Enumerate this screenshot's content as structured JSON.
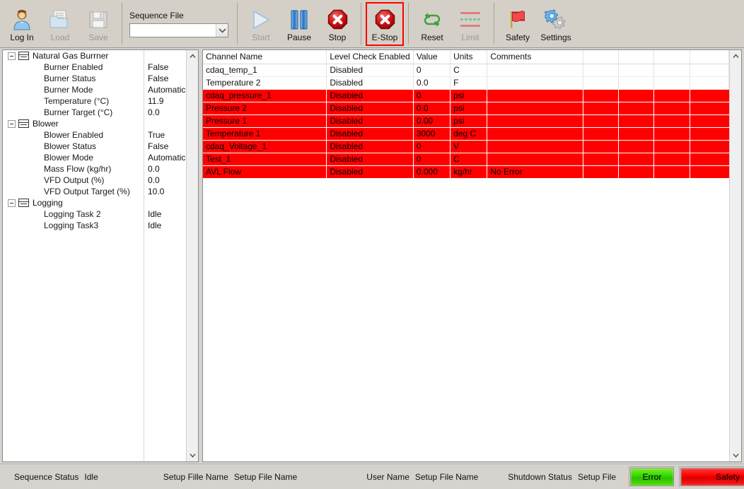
{
  "toolbar": {
    "buttons": [
      {
        "name": "log-in",
        "label": "Log In",
        "icon": "user-icon",
        "disabled": false,
        "selected": false
      },
      {
        "name": "load",
        "label": "Load",
        "icon": "folder-icon",
        "disabled": true,
        "selected": false
      },
      {
        "name": "save",
        "label": "Save",
        "icon": "floppy-icon",
        "disabled": true,
        "selected": false
      },
      {
        "name": "start",
        "label": "Start",
        "icon": "play-icon",
        "disabled": true,
        "selected": false
      },
      {
        "name": "pause",
        "label": "Pause",
        "icon": "pause-icon",
        "disabled": false,
        "selected": false
      },
      {
        "name": "stop",
        "label": "Stop",
        "icon": "stop-octagon-icon",
        "disabled": false,
        "selected": false
      },
      {
        "name": "e-stop",
        "label": "E-Stop",
        "icon": "stop-octagon-icon",
        "disabled": false,
        "selected": true
      },
      {
        "name": "reset",
        "label": "Reset",
        "icon": "refresh-cycle-icon",
        "disabled": false,
        "selected": false
      },
      {
        "name": "limit",
        "label": "Limit",
        "icon": "limit-lines-icon",
        "disabled": true,
        "selected": false
      },
      {
        "name": "safety",
        "label": "Safety",
        "icon": "red-flag-icon",
        "disabled": false,
        "selected": false
      },
      {
        "name": "settings",
        "label": "Settings",
        "icon": "gears-icon",
        "disabled": false,
        "selected": false
      }
    ],
    "sequence_file": {
      "caption": "Sequence File",
      "value": "",
      "placeholder": ""
    },
    "selection_color": "#ff0000"
  },
  "tree": {
    "groups": [
      {
        "label": "Natural Gas Burrner",
        "expanded": true,
        "items": [
          {
            "label": "Burner Enabled",
            "value": "False"
          },
          {
            "label": "Burner Status",
            "value": "False"
          },
          {
            "label": "Burner Mode",
            "value": "Automatic"
          },
          {
            "label": "Temperature (°C)",
            "value": "11.9"
          },
          {
            "label": "Burner Target (°C)",
            "value": "0.0"
          }
        ]
      },
      {
        "label": "Blower",
        "expanded": true,
        "items": [
          {
            "label": "Blower Enabled",
            "value": "True"
          },
          {
            "label": "Blower Status",
            "value": "False"
          },
          {
            "label": "Blower Mode",
            "value": "Automatic"
          },
          {
            "label": "Mass Flow (kg/hr)",
            "value": "0.0"
          },
          {
            "label": "VFD Output (%)",
            "value": "0.0"
          },
          {
            "label": "VFD Output Target (%)",
            "value": "10.0"
          }
        ]
      },
      {
        "label": "Logging",
        "expanded": true,
        "items": [
          {
            "label": "Logging Task 2",
            "value": "Idle"
          },
          {
            "label": "Logging Task3",
            "value": "Idle"
          }
        ]
      }
    ]
  },
  "channel_table": {
    "columns": [
      "Channel Name",
      "Level Check Enabled",
      "Value",
      "Units",
      "Comments",
      "",
      "",
      "",
      ""
    ],
    "alarm_color": "#ff0000",
    "rows": [
      {
        "alarm": false,
        "cells": [
          "cdaq_temp_1",
          "Disabled",
          "0",
          "C",
          "",
          "",
          "",
          "",
          ""
        ]
      },
      {
        "alarm": false,
        "cells": [
          "Temperature 2",
          "Disabled",
          "0.0",
          "F",
          "",
          "",
          "",
          "",
          ""
        ]
      },
      {
        "alarm": true,
        "cells": [
          "cdaq_pressure_1",
          "Disabled",
          "0",
          "psi",
          "",
          "",
          "",
          "",
          ""
        ]
      },
      {
        "alarm": true,
        "cells": [
          "Pressure 2",
          "Disabled",
          "0.0",
          "psi",
          "",
          "",
          "",
          "",
          ""
        ]
      },
      {
        "alarm": true,
        "cells": [
          "Pressure 1",
          "Disabled",
          "0.00",
          "psi",
          "",
          "",
          "",
          "",
          ""
        ]
      },
      {
        "alarm": true,
        "cells": [
          "Temperature 1",
          "Disabled",
          "3000",
          "deg C",
          "",
          "",
          "",
          "",
          ""
        ]
      },
      {
        "alarm": true,
        "cells": [
          "cdaq_Voltage_1",
          "Disabled",
          "0",
          "V",
          "",
          "",
          "",
          "",
          ""
        ]
      },
      {
        "alarm": true,
        "cells": [
          "Test_1",
          "Disabled",
          "0",
          "C",
          "",
          "",
          "",
          "",
          ""
        ]
      },
      {
        "alarm": true,
        "cells": [
          "AVL Flow",
          "Disabled",
          "0.000",
          "kg/hr",
          "No Error",
          "",
          "",
          "",
          ""
        ]
      }
    ]
  },
  "statusbar": {
    "sequence_status_label": "Sequence Status",
    "sequence_status_value": "Idle",
    "setup_file_label": "Setup Fille Name",
    "setup_file_value": "Setup File Name",
    "user_name_label": "User Name",
    "user_name_value": "Setup File Name",
    "shutdown_status_label": "Shutdown Status",
    "shutdown_status_value": "Setup File",
    "error_led_label": "Error",
    "error_led_color": "#33d600",
    "safety_led_label": "Safety",
    "safety_led_color": "#ff0000"
  }
}
